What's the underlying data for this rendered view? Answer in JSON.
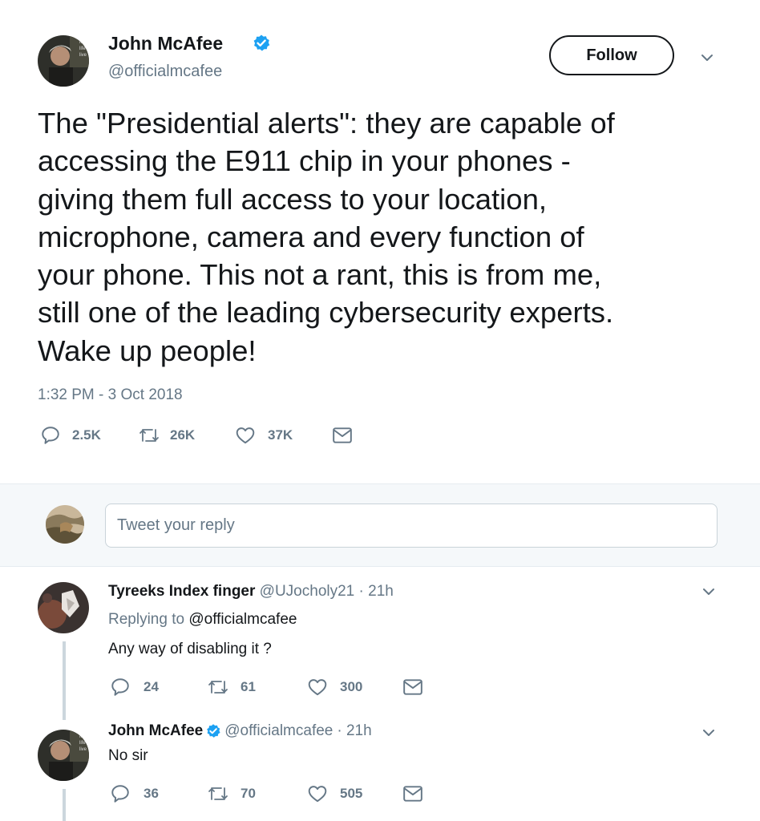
{
  "tweet": {
    "author_name": "John McAfee",
    "author_handle": "@officialmcafee",
    "follow_label": "Follow",
    "text_lines": [
      "The \"Presidential alerts\": they are capable of",
      "accessing the E911 chip in your phones -",
      "giving them full access to your location,",
      "microphone, camera and every function of",
      "your phone. This not a rant, this is from me,",
      "still one of the leading cybersecurity experts.",
      "Wake up people!"
    ],
    "timestamp": "1:32 PM - 3 Oct 2018",
    "replies": "2.5K",
    "retweets": "26K",
    "likes": "37K"
  },
  "composer": {
    "placeholder": "Tweet your reply"
  },
  "reply1": {
    "name": "Tyreeks Index finger",
    "handle": "@UJocholy21",
    "time": "· 21h",
    "replying_prefix": "Replying to",
    "replying_handle": "@officialmcafee",
    "text": "Any way of disabling it ?",
    "replies": "24",
    "retweets": "61",
    "likes": "300"
  },
  "reply2": {
    "name": "John McAfee",
    "handle": "@officialmcafee",
    "time": "· 21h",
    "text": "No sir",
    "replies": "36",
    "retweets": "70",
    "likes": "505"
  },
  "colors": {
    "verified": "#1da1f2",
    "muted": "#657786",
    "link": "#1b95e0"
  },
  "icons": [
    "reply-icon",
    "retweet-icon",
    "like-icon",
    "dm-icon",
    "verified-icon",
    "chevron-down-icon"
  ]
}
